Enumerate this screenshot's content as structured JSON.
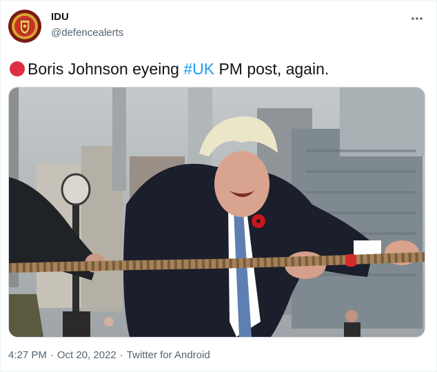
{
  "author": {
    "display_name": "IDU",
    "handle": "@defencealerts",
    "avatar_icon": "shield-emblem-icon"
  },
  "tweet": {
    "emoji": "red-circle",
    "text_before": "Boris Johnson eyeing ",
    "hashtag": "#UK",
    "text_after": " PM post, again."
  },
  "media": {
    "alt_icon": "photo-image"
  },
  "meta": {
    "time": "4:27 PM",
    "separator": "·",
    "date": "Oct 20, 2022",
    "source": "Twitter for Android"
  },
  "colors": {
    "link": "#1d9bf0",
    "secondary_text": "#536471",
    "primary_text": "#0f1419",
    "red_circle": "#dd2e44"
  }
}
